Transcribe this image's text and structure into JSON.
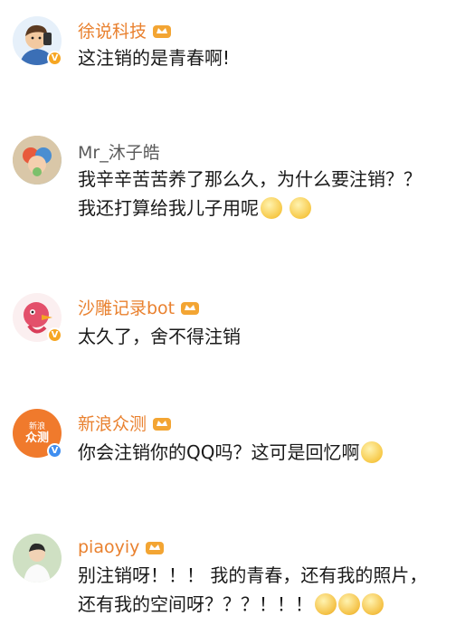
{
  "comments": [
    {
      "name": "徐说科技",
      "lines": [
        "这注销的是青春啊!"
      ],
      "verified": "gold"
    },
    {
      "name": "Mr_沐子皓",
      "lines": [
        "我辛辛苦苦养了那么久，为什么要注销？？",
        "我还打算给我儿子用呢"
      ],
      "emojis": [
        "shush-emoji",
        "shush-emoji"
      ]
    },
    {
      "name": "沙雕记录bot",
      "lines": [
        "太久了，舍不得注销"
      ],
      "verified": "gold"
    },
    {
      "name": "新浪众测",
      "avatar_text": [
        "新浪",
        "众测"
      ],
      "lines": [
        "你会注销你的QQ吗？这可是回忆啊"
      ],
      "emojis": [
        "sad-emoji"
      ],
      "verified": "blue"
    },
    {
      "name": "piaoyiy",
      "lines": [
        "别注销呀！！！ 我的青春，还有我的照片，",
        "还有我的空间呀？？？！！！"
      ],
      "emojis": [
        "crying-emoji",
        "crying-emoji",
        "crying-emoji"
      ]
    }
  ],
  "colors": {
    "name_orange": "#e9812f",
    "name_gray": "#5a5a5a",
    "text": "#1a1a1a"
  }
}
